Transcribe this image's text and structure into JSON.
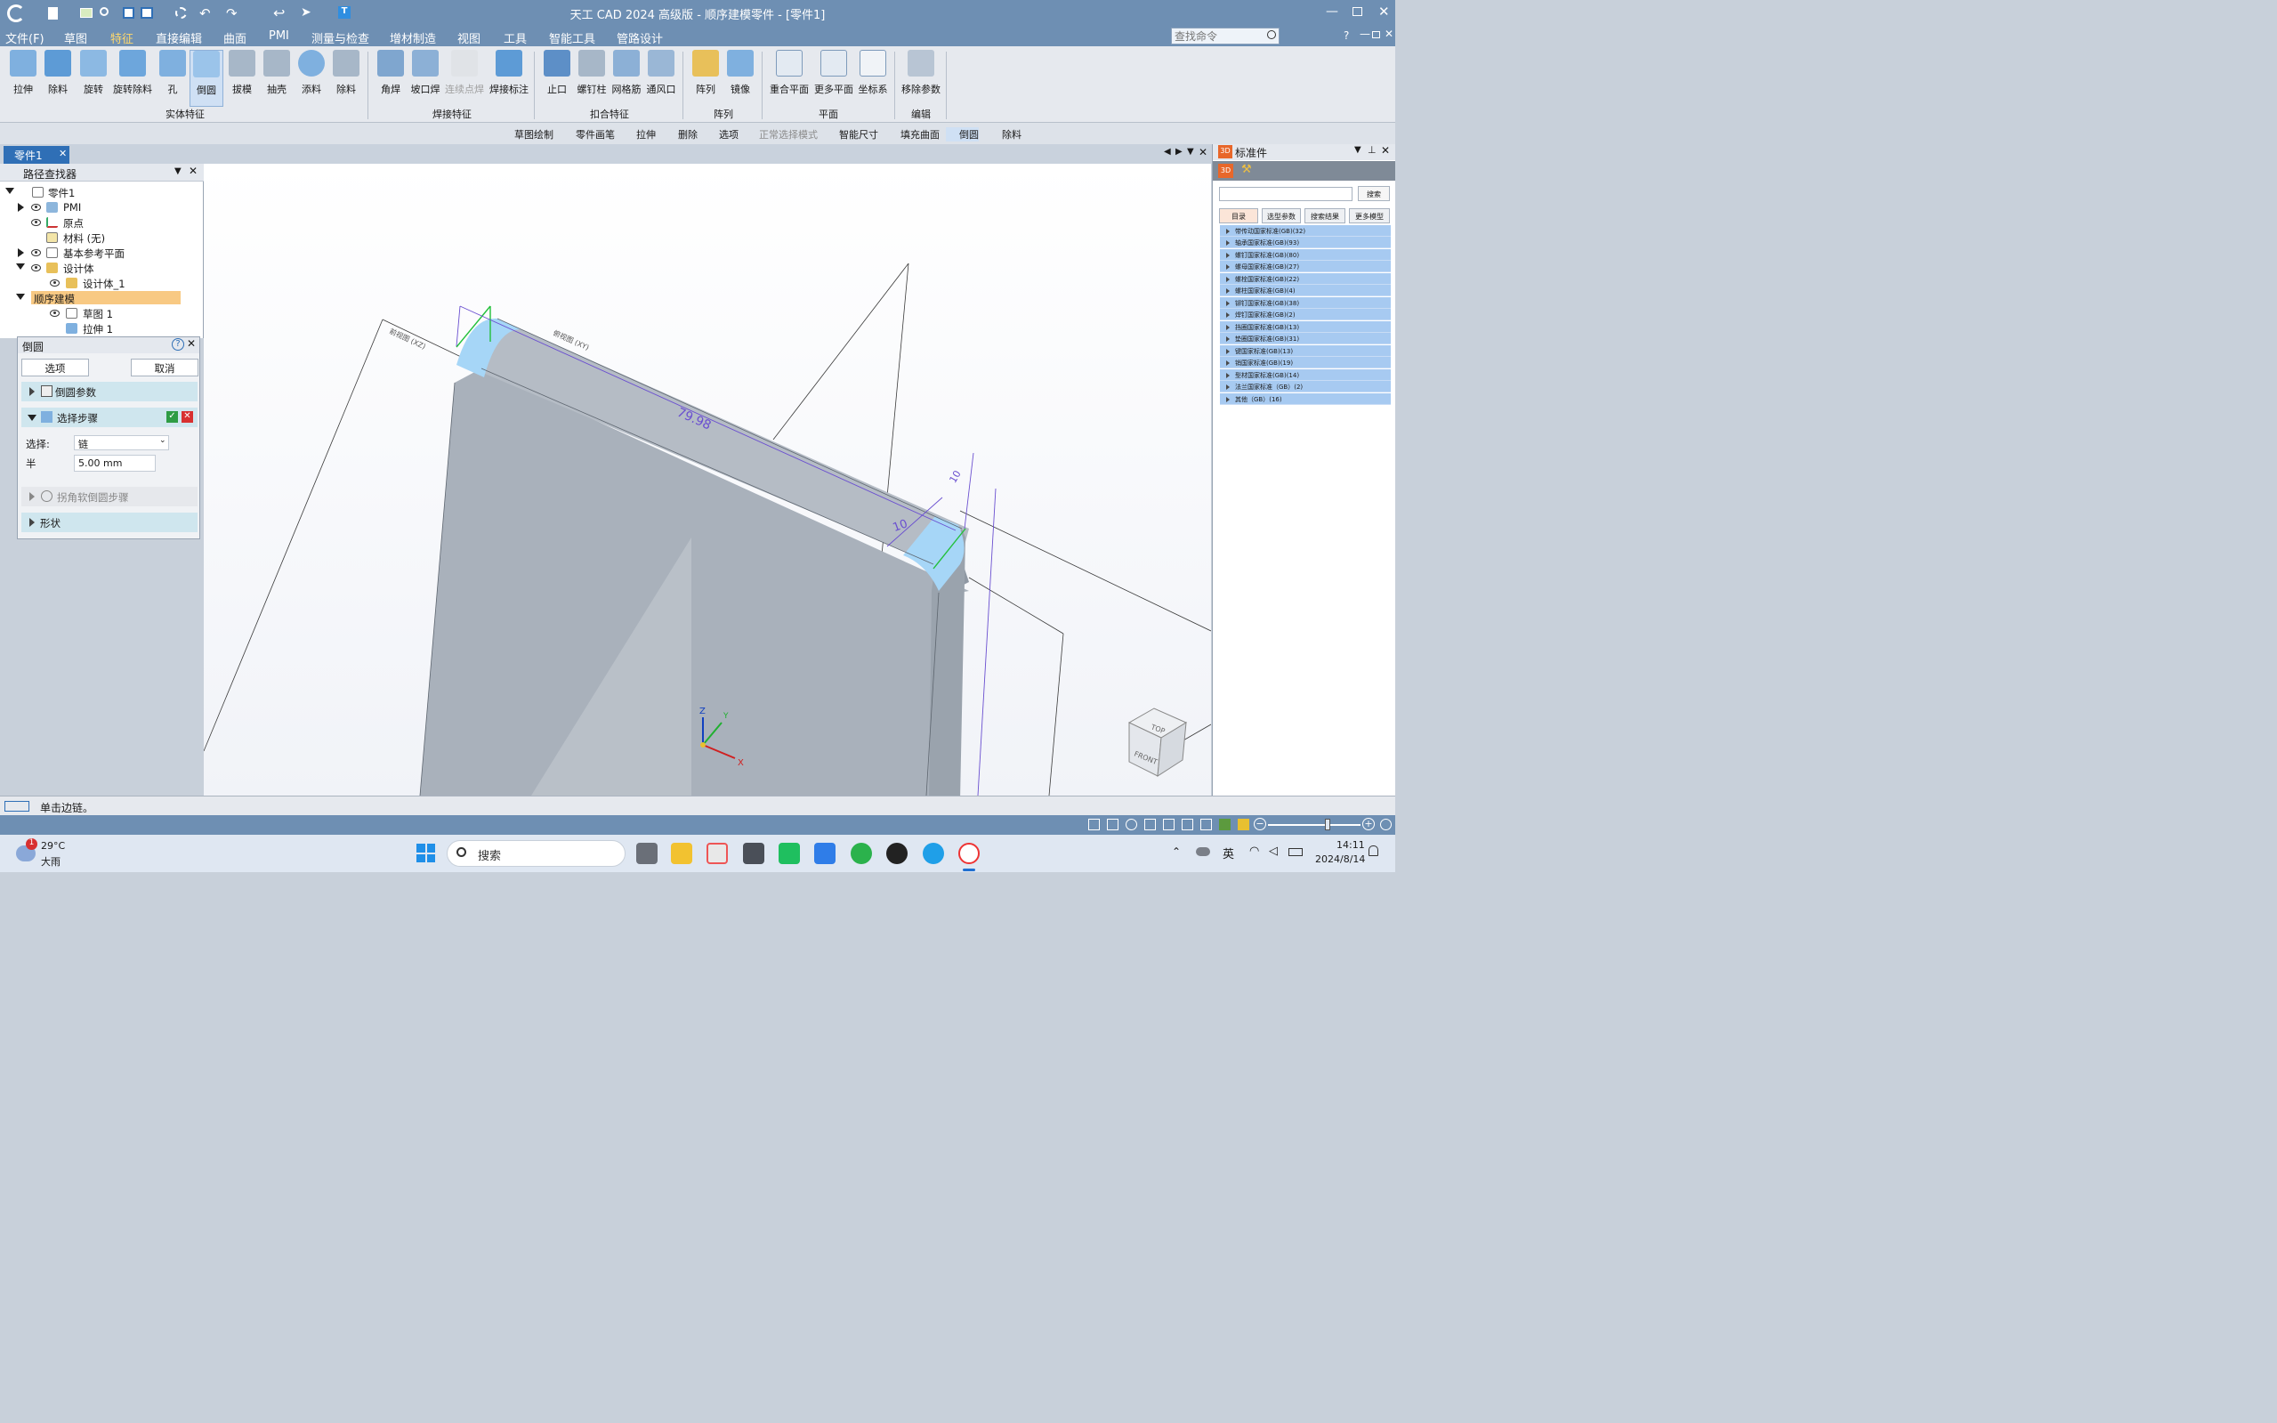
{
  "app": {
    "title": "天工 CAD 2024 高级版 - 顺序建模零件 - [零件1]"
  },
  "menu": {
    "file": "文件(F)",
    "items": [
      "草图",
      "特征",
      "直接编辑",
      "曲面",
      "PMI",
      "测量与检查",
      "增材制造",
      "视图",
      "工具",
      "智能工具",
      "管路设计"
    ],
    "active": "特征",
    "search_placeholder": "查找命令"
  },
  "ribbon": {
    "solid": [
      "拉伸",
      "除料",
      "旋转",
      "旋转除料",
      "孔",
      "倒圆",
      "拔模",
      "抽壳",
      "添料",
      "除料"
    ],
    "solid_group": "实体特征",
    "weld": [
      "角焊",
      "坡口焊",
      "连续点焊",
      "焊接标注"
    ],
    "weld_group": "焊接特征",
    "fit": [
      "止口",
      "螺钉柱",
      "网格筋",
      "通风口"
    ],
    "fit_group": "扣合特征",
    "pattern": [
      "阵列",
      "镜像"
    ],
    "pattern_group": "阵列",
    "plane": [
      "重合平面",
      "更多平面",
      "坐标系"
    ],
    "plane_group": "平面",
    "edit": [
      "移除参数"
    ],
    "edit_group": "编辑"
  },
  "cmdbar": [
    "草图绘制",
    "零件画笔",
    "拉伸",
    "删除",
    "选项",
    "正常选择模式",
    "智能尺寸",
    "填充曲面",
    "倒圆",
    "除料"
  ],
  "doc_tab": "零件1",
  "pathfinder": {
    "title": "路径查找器",
    "items": [
      "零件1",
      "PMI",
      "原点",
      "材料 (无)",
      "基本参考平面",
      "设计体",
      "设计体_1",
      "顺序建模",
      "草图 1",
      "拉伸 1"
    ]
  },
  "fillet": {
    "title": "倒圆",
    "options": "选项",
    "cancel": "取消",
    "params": "倒圆参数",
    "step": "选择步骤",
    "select_label": "选择:",
    "select_value": "链",
    "radius_label": "半",
    "radius_value": "5.00 mm",
    "corner": "拐角软倒圆步骤",
    "shape": "形状"
  },
  "viewport": {
    "dim1": "79.98",
    "dim2": "10",
    "dim3": "10",
    "plane_xz": "前视图 (XZ)",
    "plane_xy": "俯视图 (XY)",
    "cube_top": "TOP",
    "cube_front": "FRONT",
    "axis_x": "X",
    "axis_y": "Y",
    "axis_z": "Z"
  },
  "std_panel": {
    "title": "标准件",
    "search_btn": "搜索",
    "tabs": [
      "目录",
      "选型参数",
      "搜索结果",
      "更多模型"
    ],
    "items": [
      "带传动国家标准(GB)(32)",
      "轴承国家标准(GB)(93)",
      "螺钉国家标准(GB)(80)",
      "螺母国家标准(GB)(27)",
      "螺栓国家标准(GB)(22)",
      "螺柱国家标准(GB)(4)",
      "铆钉国家标准(GB)(38)",
      "焊钉国家标准(GB)(2)",
      "挡圈国家标准(GB)(13)",
      "垫圈国家标准(GB)(31)",
      "键国家标准(GB)(13)",
      "销国家标准(GB)(19)",
      "型材国家标准(GB)(14)",
      "法兰国家标准（GB）(2)",
      "其他（GB）(16)"
    ]
  },
  "status": "单击边链。",
  "taskbar": {
    "temp": "29°C",
    "weather": "大雨",
    "badge": "1",
    "search": "搜索",
    "ime": "英",
    "time": "14:11",
    "date": "2024/8/14"
  }
}
